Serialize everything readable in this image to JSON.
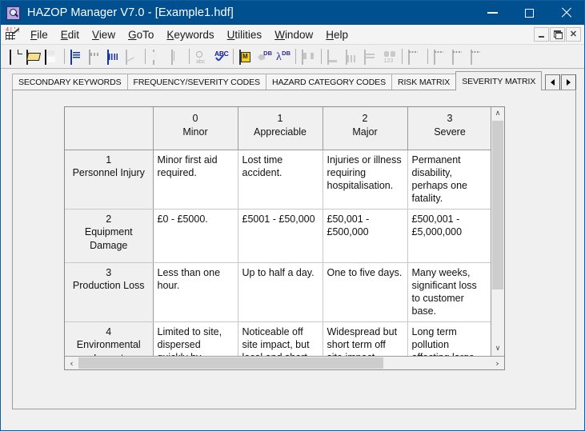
{
  "window": {
    "title": "HAZOP Manager V7.0 - [Example1.hdf]",
    "app_icon": "magnifier-icon",
    "controls": {
      "minimize": "minimize-icon",
      "maximize": "maximize-icon",
      "close": "close-icon"
    },
    "title_bar_color": "#00508f",
    "frame_color": "#0f5c9e"
  },
  "menu": {
    "doc_icon": "document-grid-icon",
    "items": [
      {
        "label": "File",
        "pre": "F",
        "rest": "ile"
      },
      {
        "label": "Edit",
        "pre": "E",
        "rest": "dit"
      },
      {
        "label": "View",
        "pre": "V",
        "rest": "iew"
      },
      {
        "label": "GoTo",
        "pre": "G",
        "rest": "oTo"
      },
      {
        "label": "Keywords",
        "pre": "K",
        "rest": "eywords"
      },
      {
        "label": "Utilities",
        "pre": "U",
        "rest": "tilities"
      },
      {
        "label": "Window",
        "pre": "W",
        "rest": "indow"
      },
      {
        "label": "Help",
        "pre": "H",
        "rest": "elp"
      }
    ],
    "mdi_controls": {
      "minimize": "mdi-minimize-icon",
      "restore": "mdi-restore-icon",
      "close": "mdi-close-icon",
      "close_glyph": "✕"
    }
  },
  "toolbar": {
    "buttons": [
      {
        "name": "new-file-icon",
        "enabled": true
      },
      {
        "name": "open-file-icon",
        "enabled": true
      },
      {
        "name": "save-file-icon",
        "enabled": true
      },
      {
        "name": "node-list-icon",
        "enabled": true
      },
      {
        "name": "worksheet-icon",
        "enabled": false
      },
      {
        "name": "table-view-icon",
        "enabled": true
      },
      {
        "name": "chart-edit-icon",
        "enabled": false
      },
      {
        "name": "cut-icon",
        "enabled": false
      },
      {
        "name": "paste-icon",
        "enabled": false
      },
      {
        "name": "find-icon",
        "enabled": false
      },
      {
        "name": "spell-check-icon",
        "enabled": true
      },
      {
        "name": "report-icon",
        "enabled": true
      },
      {
        "name": "database-export-icon",
        "enabled": false
      },
      {
        "name": "database-lambda-icon",
        "enabled": true
      },
      {
        "name": "matrix-icon",
        "enabled": false
      },
      {
        "name": "bar-chart-icon",
        "enabled": false
      },
      {
        "name": "column-chart-icon",
        "enabled": false
      },
      {
        "name": "range-chart-icon",
        "enabled": false
      },
      {
        "name": "binoculars-icon",
        "enabled": false
      },
      {
        "name": "window-tile-icon",
        "enabled": false
      },
      {
        "name": "window-cascade-icon",
        "enabled": false
      },
      {
        "name": "window-horizontal-icon",
        "enabled": false
      },
      {
        "name": "window-vertical-icon",
        "enabled": false
      }
    ]
  },
  "tabs": {
    "items": [
      {
        "label": "SECONDARY KEYWORDS",
        "active": false
      },
      {
        "label": "FREQUENCY/SEVERITY CODES",
        "active": false
      },
      {
        "label": "HAZARD CATEGORY CODES",
        "active": false
      },
      {
        "label": "RISK MATRIX",
        "active": false
      },
      {
        "label": "SEVERITY MATRIX",
        "active": true
      }
    ],
    "scroll_prev_icon": "triangle-left-icon",
    "scroll_next_icon": "triangle-right-icon"
  },
  "matrix": {
    "corner_label": "",
    "columns": [
      {
        "num": "0",
        "label": "Minor"
      },
      {
        "num": "1",
        "label": "Appreciable"
      },
      {
        "num": "2",
        "label": "Major"
      },
      {
        "num": "3",
        "label": "Severe"
      }
    ],
    "rows": [
      {
        "num": "1",
        "label": "Personnel Injury",
        "cells": [
          "Minor first aid required.",
          "Lost time accident.",
          "Injuries or illness requiring hospitalisation.",
          "Permanent disability, perhaps one fatality."
        ]
      },
      {
        "num": "2",
        "label": "Equipment Damage",
        "cells": [
          "£0 - £5000.",
          "£5001 - £50,000",
          "£50,001 - £500,000",
          "£500,001 - £5,000,000"
        ]
      },
      {
        "num": "3",
        "label": "Production Loss",
        "cells": [
          "Less than one hour.",
          "Up to half a day.",
          "One to five days.",
          "Many weeks, significant loss to customer base."
        ]
      },
      {
        "num": "4",
        "label": "Environmental Impact",
        "cells": [
          "Limited to site, dispersed quickly by natural means.",
          "Noticeable off site impact, but local and short term.",
          "Widespread but short term off site impact.",
          "Long term pollution affecting large area."
        ]
      }
    ]
  },
  "scrollbars": {
    "vertical": {
      "up_icon": "chevron-up-icon",
      "down_icon": "chevron-down-icon",
      "up_glyph": "∧",
      "down_glyph": "∨"
    },
    "horizontal": {
      "left_icon": "chevron-left-icon",
      "right_icon": "chevron-right-icon",
      "left_glyph": "‹",
      "right_glyph": "›"
    }
  }
}
